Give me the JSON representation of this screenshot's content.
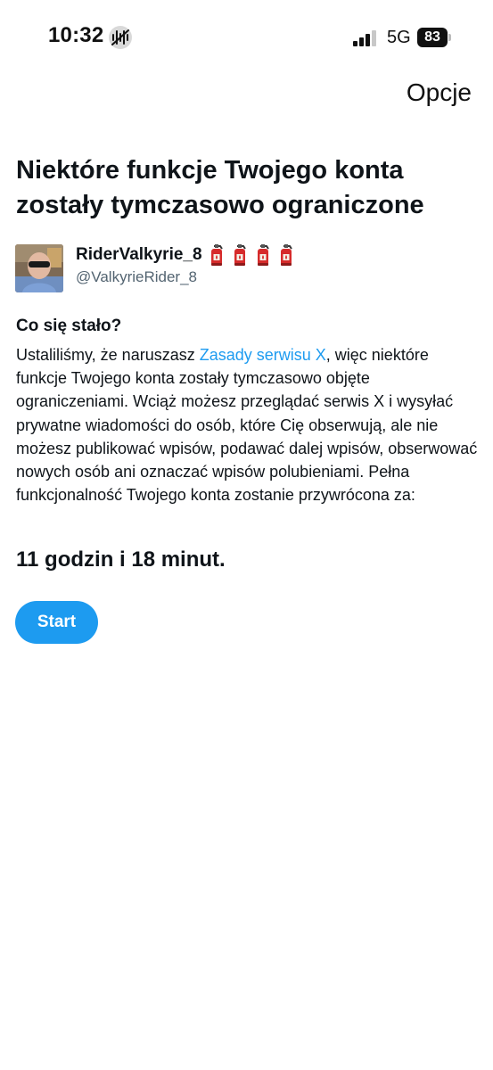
{
  "status_bar": {
    "time": "10:32",
    "network": "5G",
    "battery": "83"
  },
  "header": {
    "options_label": "Opcje"
  },
  "heading": "Niektóre funkcje Twojego konta zostały tymczasowo ograniczone",
  "account": {
    "display_name": "RiderValkyrie_8",
    "handle": "@ValkyrieRider_8",
    "name_emoji": [
      "fire-extinguisher",
      "fire-extinguisher",
      "fire-extinguisher",
      "fire-extinguisher"
    ]
  },
  "what_happened": {
    "title": "Co się stało?",
    "text_before_link": "Ustaliliśmy, że naruszasz ",
    "link_text": "Zasady serwisu X",
    "text_after_link": ", więc niektóre funkcje Twojego konta zostały tymczasowo objęte ograniczeniami. Wciąż możesz przeglądać serwis X i wysyłać prywatne wiadomości do osób, które Cię obserwują, ale nie możesz publikować wpisów, podawać dalej wpisów, obserwować nowych osób ani oznaczać wpisów polubieniami. Pełna funkcjonalność Twojego konta zostanie przywrócona za:"
  },
  "countdown": "11 godzin i 18 minut.",
  "start_button_label": "Start",
  "colors": {
    "accent": "#1d9bf0",
    "text": "#0f1419",
    "secondary_text": "#536471"
  }
}
